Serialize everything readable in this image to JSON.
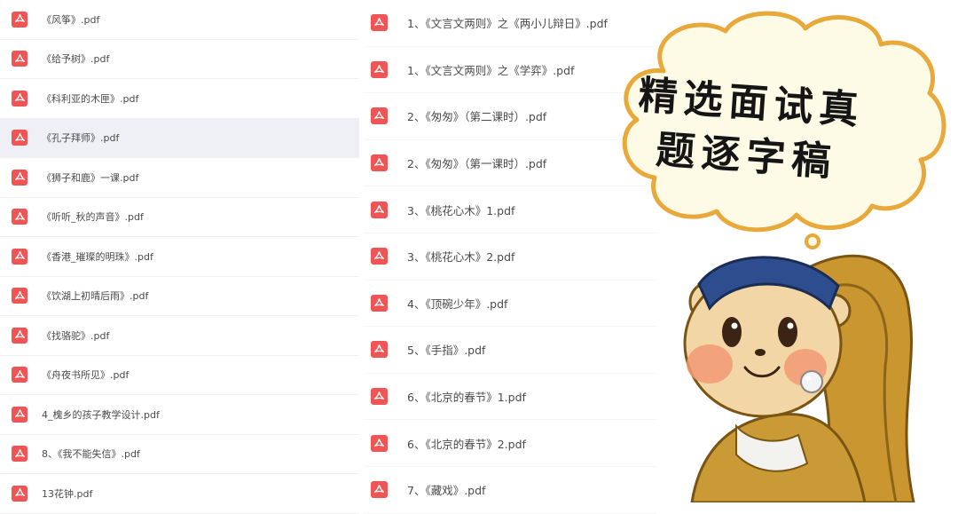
{
  "left_files": [
    "《风筝》.pdf",
    "《给予树》.pdf",
    "《科利亚的木匣》.pdf",
    "《孔子拜师》.pdf",
    "《狮子和鹿》一课.pdf",
    "《听听_秋的声音》.pdf",
    "《香港_璀璨的明珠》.pdf",
    "《饮湖上初晴后雨》.pdf",
    "《找骆驼》.pdf",
    "《舟夜书所见》.pdf",
    "4_槐乡的孩子教学设计.pdf",
    "8、《我不能失信》.pdf",
    "13花钟.pdf"
  ],
  "right_files": [
    "1、《文言文两则》之《两小儿辩日》.pdf",
    "1、《文言文两则》之《学弈》.pdf",
    "2、《匆匆》（第二课时）.pdf",
    "2、《匆匆》（第一课时）.pdf",
    "3、《桃花心木》1.pdf",
    "3、《桃花心木》2.pdf",
    "4、《顶碗少年》.pdf",
    "5、《手指》.pdf",
    "6、《北京的春节》1.pdf",
    "6、《北京的春节》2.pdf",
    "7、《藏戏》.pdf"
  ],
  "highlighted_left_index": 3,
  "bubble": {
    "line1": "精选面试真",
    "line2": "题逐字稿"
  },
  "icons": {
    "file": "pdf-file-icon"
  },
  "colors": {
    "pdf_icon": "#f05555",
    "highlight_row": "#eef0f6",
    "bubble_fill": "#fdfbe6",
    "bubble_outline": "#e8a83a"
  }
}
